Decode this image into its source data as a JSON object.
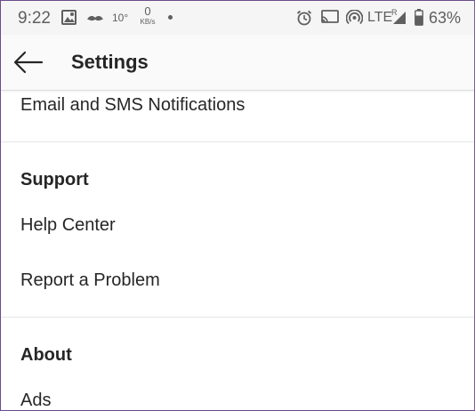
{
  "status_bar": {
    "time": "9:22",
    "temperature": "10°",
    "speed_value": "0",
    "speed_unit": "KB/s",
    "network": "LTE",
    "roaming": "R",
    "battery": "63%",
    "icons": [
      "gallery-icon",
      "mustache-icon",
      "alarm-icon",
      "cast-icon",
      "hotspot-icon",
      "signal-icon",
      "battery-icon"
    ]
  },
  "toolbar": {
    "back_icon": "arrow-left-icon",
    "title": "Settings"
  },
  "list": {
    "email_sms": "Email and SMS Notifications",
    "support_header": "Support",
    "help_center": "Help Center",
    "report_problem": "Report a Problem",
    "about_header": "About",
    "ads": "Ads"
  },
  "colors": {
    "text": "#262626",
    "status_text": "#5f5f5f",
    "divider": "#e6e6e6",
    "toolbar_bg": "#fafafa"
  }
}
